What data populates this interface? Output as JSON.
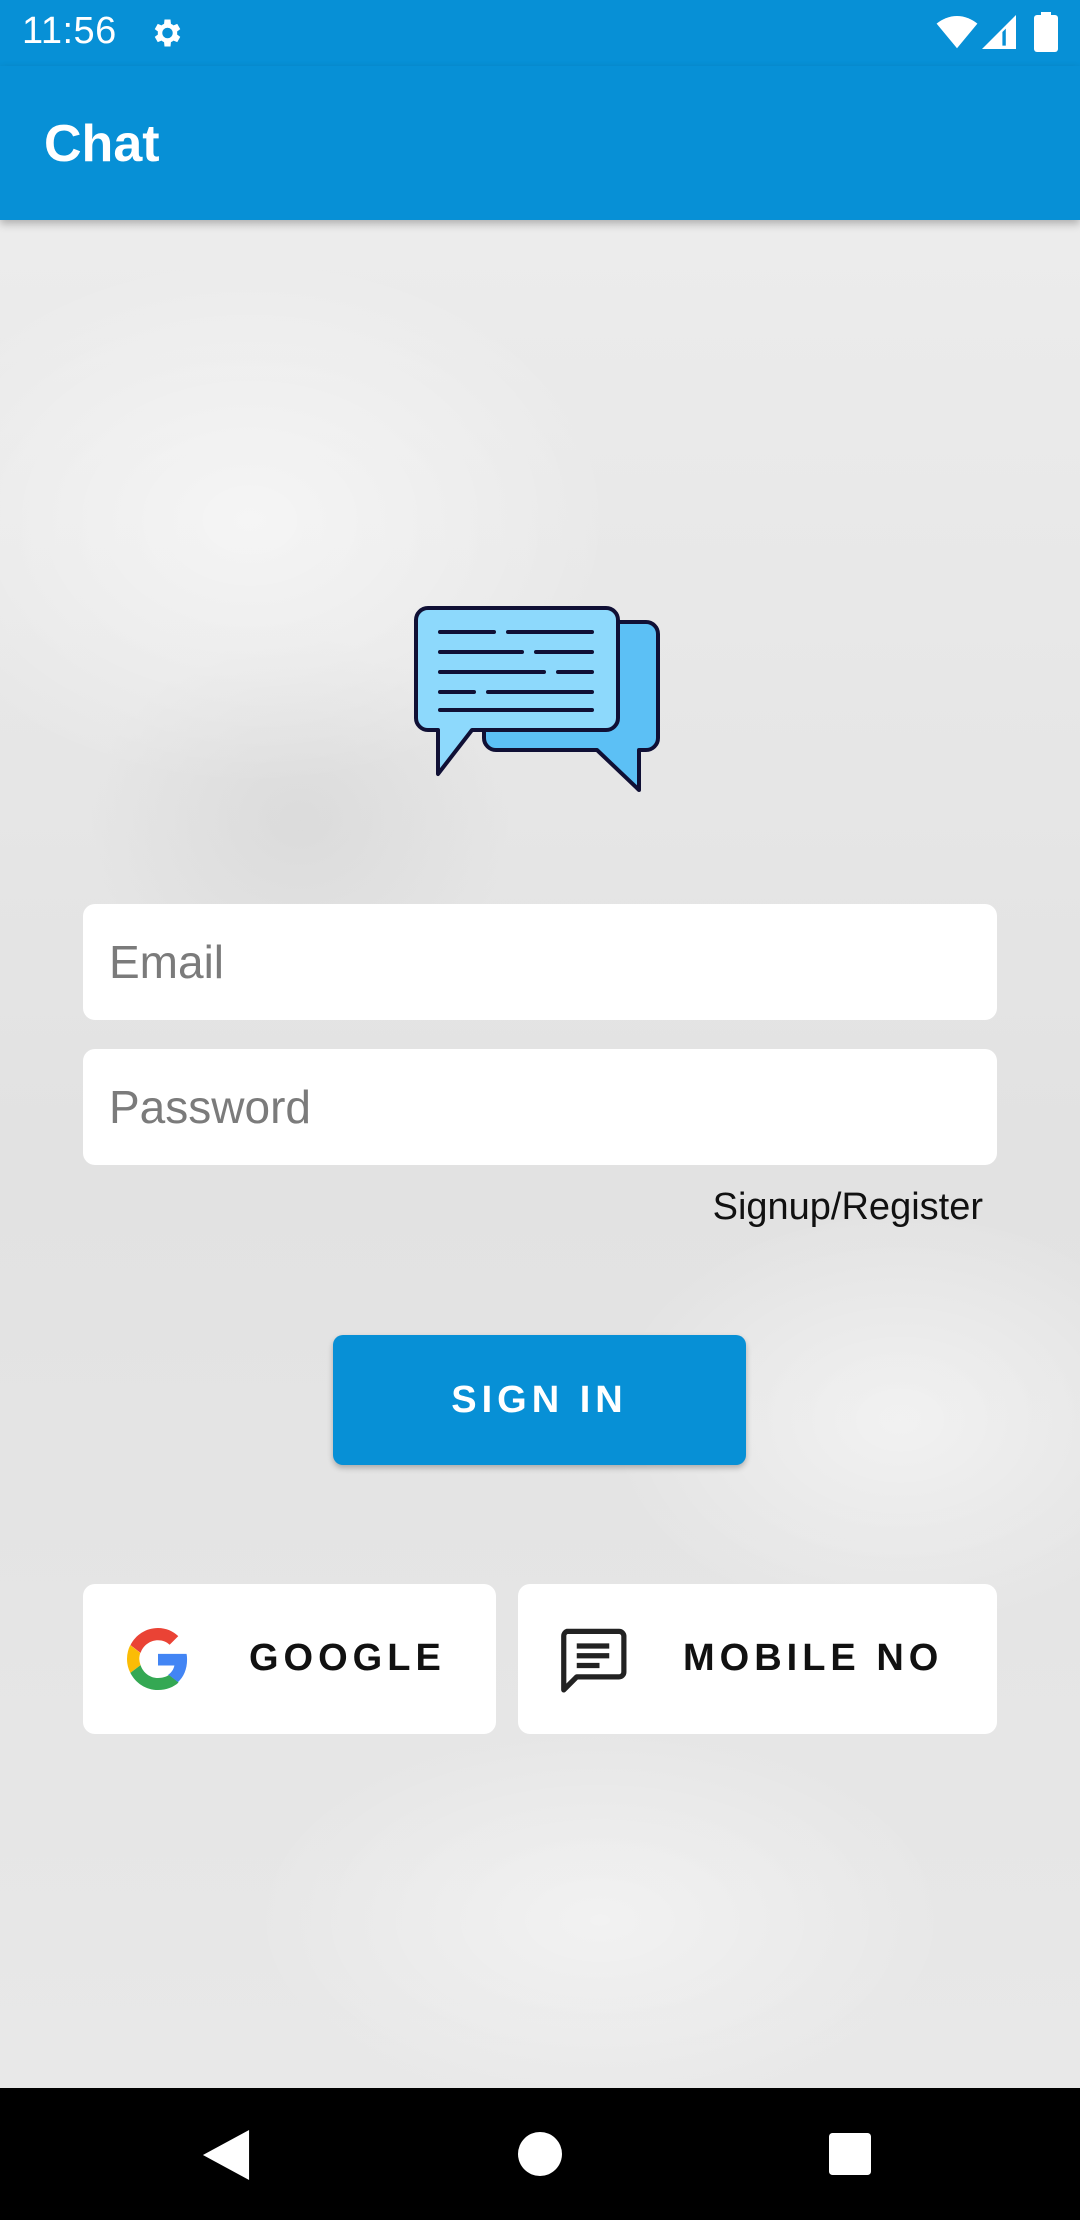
{
  "status_bar": {
    "time": "11:56",
    "icons": [
      "gear-icon",
      "wifi-icon",
      "cellular-signal-icon",
      "battery-icon"
    ]
  },
  "app_bar": {
    "title": "Chat"
  },
  "logo": {
    "icon": "chat-bubbles-icon"
  },
  "login_form": {
    "email_placeholder": "Email",
    "email_value": "",
    "password_placeholder": "Password",
    "password_value": "",
    "signup_link": "Signup/Register",
    "sign_in_label": "SIGN IN"
  },
  "social_login": {
    "google_label": "GOOGLE",
    "google_icon": "google-g-icon",
    "mobile_label": "MOBILE NO",
    "mobile_icon": "message-icon"
  },
  "nav_bar": {
    "icons": [
      "back-icon",
      "home-icon",
      "recents-icon"
    ]
  },
  "colors": {
    "primary": "#0790d6",
    "background": "#e9e9e9",
    "card": "#ffffff",
    "nav_bar": "#000000"
  }
}
